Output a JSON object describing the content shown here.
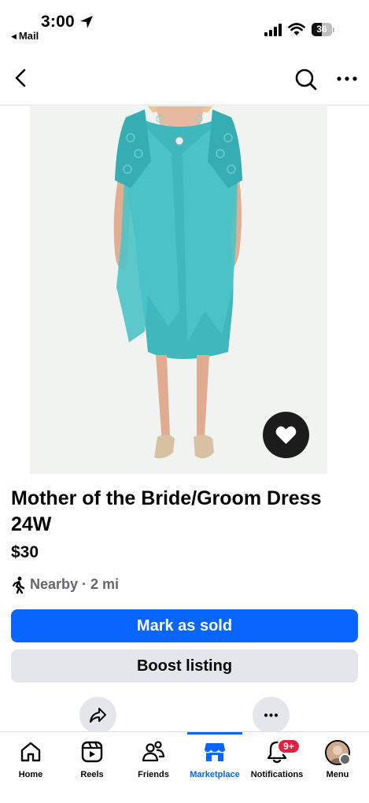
{
  "status_bar": {
    "time": "3:00",
    "back_app": "Mail",
    "battery": "36"
  },
  "listing": {
    "title": "Mother of the Bride/Groom Dress 24W",
    "price": "$30",
    "location": "Nearby · 2 mi",
    "mark_sold_label": "Mark as sold",
    "boost_label": "Boost listing"
  },
  "tabs": [
    {
      "label": "Home",
      "icon": "home-icon"
    },
    {
      "label": "Reels",
      "icon": "reels-icon"
    },
    {
      "label": "Friends",
      "icon": "friends-icon"
    },
    {
      "label": "Marketplace",
      "icon": "marketplace-icon",
      "active": true
    },
    {
      "label": "Notifications",
      "icon": "bell-icon",
      "badge": "9+"
    },
    {
      "label": "Menu",
      "icon": "avatar"
    }
  ],
  "colors": {
    "accent": "#0866ff",
    "badge": "#e41e3f",
    "secondary_button": "#e4e6eb",
    "dress": "#3fb7bc"
  }
}
